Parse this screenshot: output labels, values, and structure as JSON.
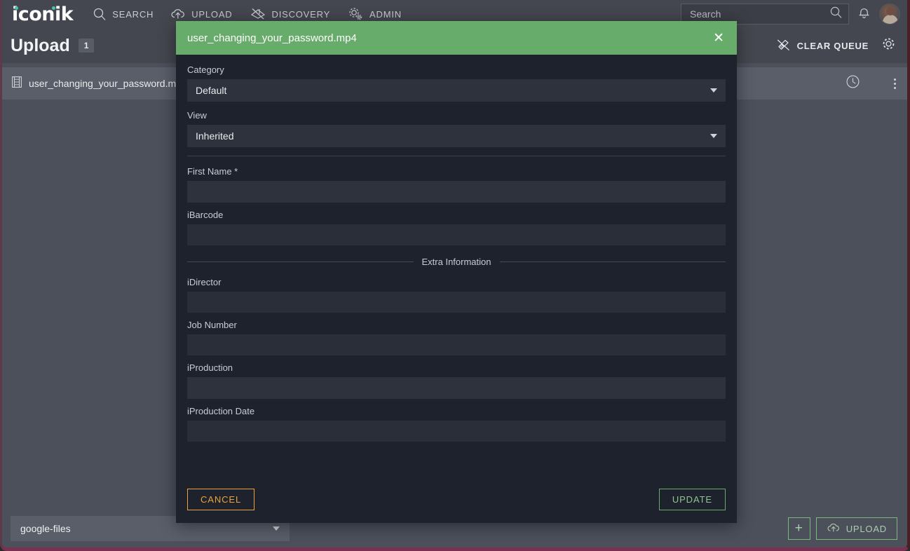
{
  "topbar": {
    "logo": "iconik",
    "nav": [
      {
        "label": "SEARCH",
        "icon": "search-icon"
      },
      {
        "label": "UPLOAD",
        "icon": "cloud-upload-icon"
      },
      {
        "label": "DISCOVERY",
        "icon": "discovery-icon"
      },
      {
        "label": "ADMIN",
        "icon": "gear-icon"
      }
    ],
    "search_placeholder": "Search",
    "search_value": "",
    "notifications_icon": "bell-icon",
    "avatar_icon": "user-avatar"
  },
  "page_header": {
    "title": "Upload",
    "count": "1",
    "clear_queue_label": "CLEAR QUEUE",
    "clear_queue_icon": "broom-icon",
    "settings_icon": "gear-icon"
  },
  "file_row": {
    "icon": "film-strip-icon",
    "name": "user_changing_your_password.mp4",
    "status_icon": "clock-icon",
    "menu_icon": "kebab-menu-icon"
  },
  "bottom_bar": {
    "storage_select_value": "google-files",
    "add_label": "+",
    "upload_label": "UPLOAD",
    "upload_icon": "cloud-upload-icon"
  },
  "modal": {
    "title": "user_changing_your_password.mp4",
    "close_icon": "close-icon",
    "category_label": "Category",
    "category_value": "Default",
    "view_label": "View",
    "view_value": "Inherited",
    "fields": [
      {
        "label": "First Name *",
        "value": "",
        "size": "tall"
      },
      {
        "label": "iBarcode",
        "value": "",
        "size": "normal"
      }
    ],
    "section_title": "Extra Information",
    "extra_fields": [
      {
        "label": "iDirector",
        "value": "",
        "size": "normal"
      },
      {
        "label": "Job Number",
        "value": "",
        "size": "normal"
      },
      {
        "label": "iProduction",
        "value": "",
        "size": "tall"
      },
      {
        "label": "iProduction Date",
        "value": "",
        "size": "normal"
      }
    ],
    "cancel_label": "CANCEL",
    "update_label": "UPDATE"
  },
  "colors": {
    "accent_green": "#68ac6b",
    "accent_orange": "#e8a33d",
    "app_bg": "#4c505b",
    "modal_bg": "#1e222c",
    "topbar_bg": "#44474f",
    "logo_dot": "#49c5a3"
  }
}
